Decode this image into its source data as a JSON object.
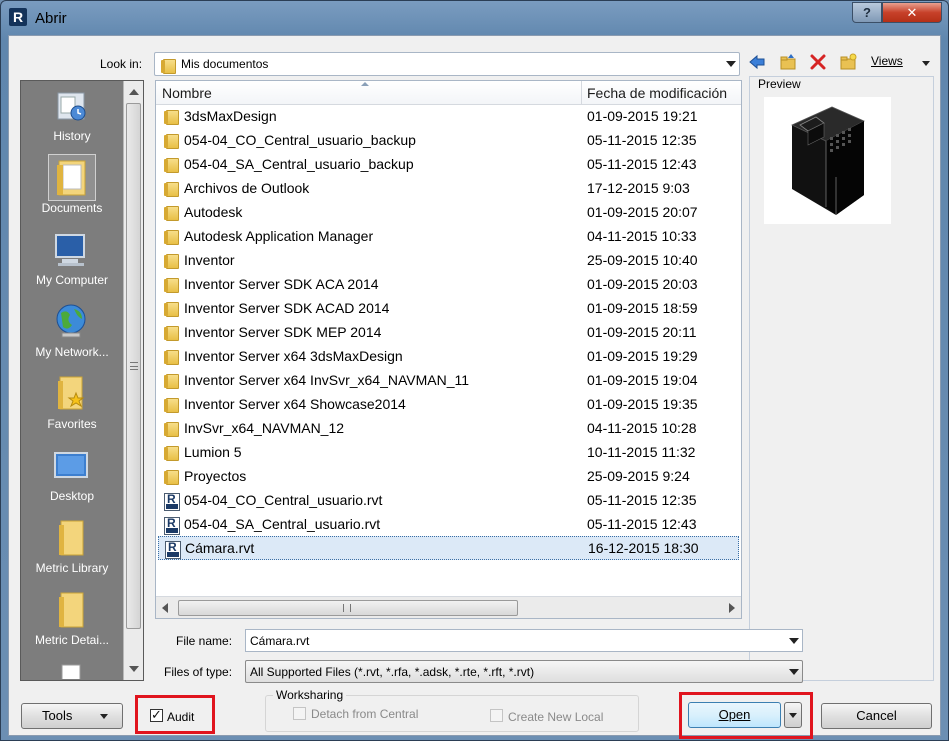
{
  "window": {
    "title": "Abrir",
    "app_icon": "R"
  },
  "titlebar": {
    "help_icon": "?",
    "close_icon": "✕"
  },
  "lookin": {
    "label": "Look in:",
    "value": "Mis documentos"
  },
  "toolbar": {
    "views_label": "Views"
  },
  "places": [
    {
      "label": "History",
      "icon": "history-icon"
    },
    {
      "label": "Documents",
      "icon": "documents-folder-icon"
    },
    {
      "label": "My Computer",
      "icon": "computer-icon"
    },
    {
      "label": "My Network...",
      "icon": "network-globe-icon"
    },
    {
      "label": "Favorites",
      "icon": "favorites-folder-icon"
    },
    {
      "label": "Desktop",
      "icon": "desktop-icon"
    },
    {
      "label": "Metric Library",
      "icon": "library-folder-icon"
    },
    {
      "label": "Metric Detai...",
      "icon": "detail-folder-icon"
    }
  ],
  "filelist": {
    "columns": {
      "name": "Nombre",
      "date": "Fecha de modificación"
    },
    "rows": [
      {
        "name": "3dsMaxDesign",
        "date": "01-09-2015 19:21",
        "type": "folder"
      },
      {
        "name": "054-04_CO_Central_usuario_backup",
        "date": "05-11-2015 12:35",
        "type": "folder"
      },
      {
        "name": "054-04_SA_Central_usuario_backup",
        "date": "05-11-2015 12:43",
        "type": "folder"
      },
      {
        "name": "Archivos de Outlook",
        "date": "17-12-2015 9:03",
        "type": "folder"
      },
      {
        "name": "Autodesk",
        "date": "01-09-2015 20:07",
        "type": "folder"
      },
      {
        "name": "Autodesk Application Manager",
        "date": "04-11-2015 10:33",
        "type": "folder"
      },
      {
        "name": "Inventor",
        "date": "25-09-2015 10:40",
        "type": "folder"
      },
      {
        "name": "Inventor Server SDK ACA 2014",
        "date": "01-09-2015 20:03",
        "type": "folder"
      },
      {
        "name": "Inventor Server SDK ACAD 2014",
        "date": "01-09-2015 18:59",
        "type": "folder"
      },
      {
        "name": "Inventor Server SDK MEP 2014",
        "date": "01-09-2015 20:11",
        "type": "folder"
      },
      {
        "name": "Inventor Server x64 3dsMaxDesign",
        "date": "01-09-2015 19:29",
        "type": "folder"
      },
      {
        "name": "Inventor Server x64 InvSvr_x64_NAVMAN_11",
        "date": "01-09-2015 19:04",
        "type": "folder"
      },
      {
        "name": "Inventor Server x64 Showcase2014",
        "date": "01-09-2015 19:35",
        "type": "folder"
      },
      {
        "name": "InvSvr_x64_NAVMAN_12",
        "date": "04-11-2015 10:28",
        "type": "folder"
      },
      {
        "name": "Lumion 5",
        "date": "10-11-2015 11:32",
        "type": "folder"
      },
      {
        "name": "Proyectos",
        "date": "25-09-2015 9:24",
        "type": "folder"
      },
      {
        "name": "054-04_CO_Central_usuario.rvt",
        "date": "05-11-2015 12:35",
        "type": "rvt"
      },
      {
        "name": "054-04_SA_Central_usuario.rvt",
        "date": "05-11-2015 12:43",
        "type": "rvt"
      },
      {
        "name": "Cámara.rvt",
        "date": "16-12-2015 18:30",
        "type": "rvt",
        "selected": true
      }
    ]
  },
  "preview": {
    "label": "Preview"
  },
  "filename": {
    "label": "File name:",
    "value": "Cámara.rvt"
  },
  "filetype": {
    "label": "Files of type:",
    "value": "All Supported Files  (*.rvt, *.rfa, *.adsk, *.rte, *.rft, *.rvt)"
  },
  "bottom": {
    "tools_label": "Tools",
    "audit_label": "Audit",
    "audit_checked": true,
    "worksharing_title": "Worksharing",
    "detach_label": "Detach from Central",
    "create_local_label": "Create New Local",
    "open_label": "Open",
    "cancel_label": "Cancel"
  },
  "colors": {
    "highlight": "#e0141e",
    "selection": "#dce9f7",
    "places_bg": "#7d7d7d"
  }
}
